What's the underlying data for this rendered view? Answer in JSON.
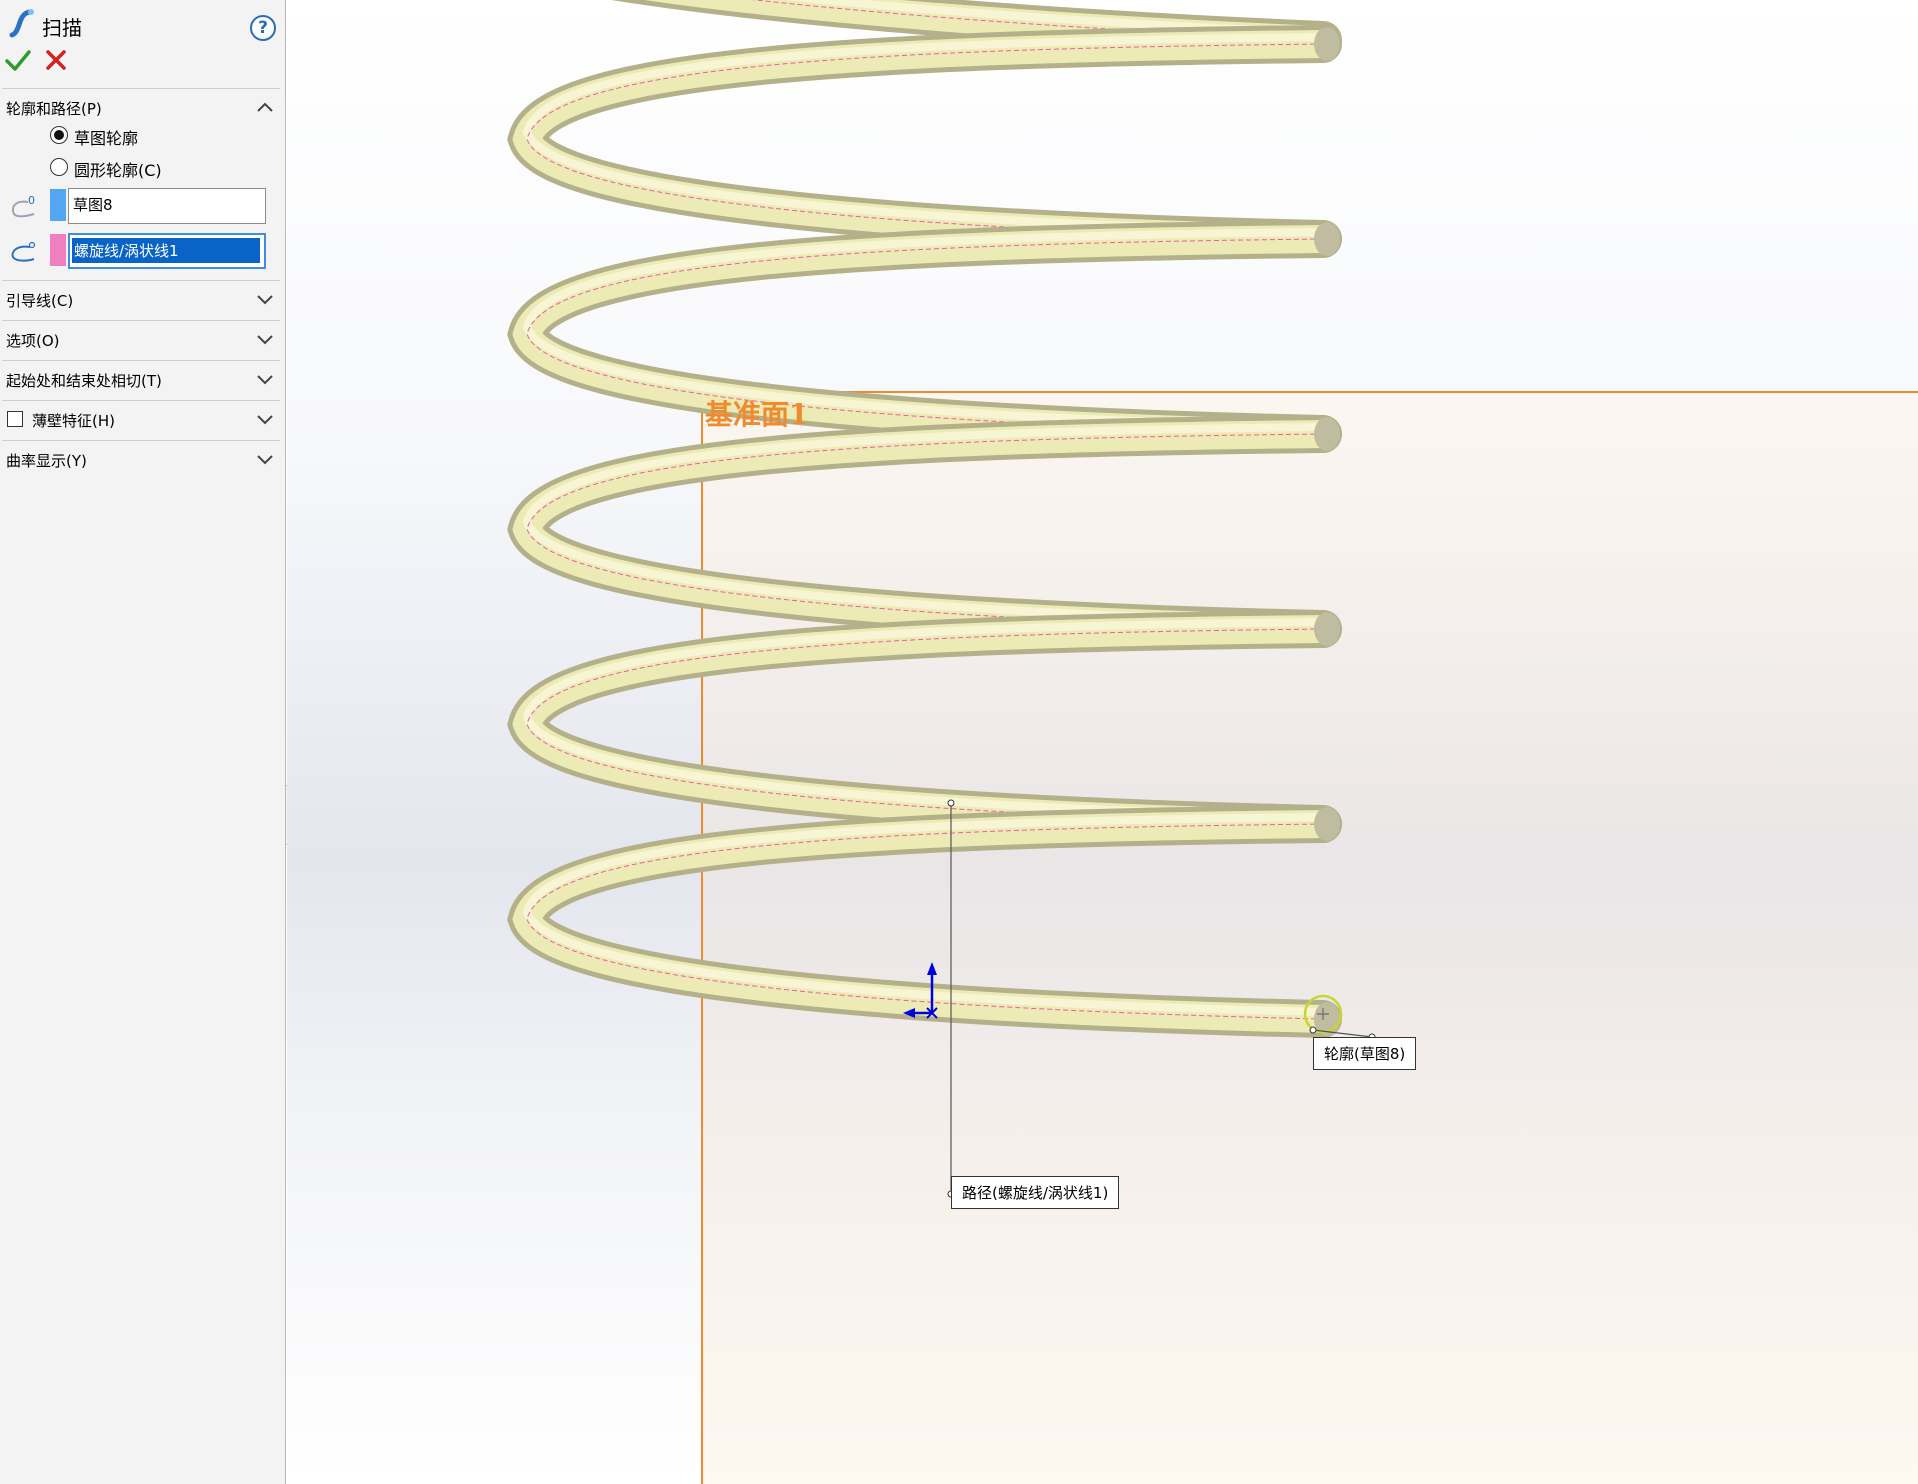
{
  "panel": {
    "title": "扫描",
    "help_label": "?",
    "groups": {
      "profile_path": "轮廓和路径(P)",
      "guide_curves": "引导线(C)",
      "options": "选项(O)",
      "tangency": "起始处和结束处相切(T)",
      "thin_feature": "薄壁特征(H)",
      "curvature_display": "曲率显示(Y)"
    },
    "radios": {
      "sketch_profile": "草图轮廓",
      "circular_profile": "圆形轮廓(C)"
    },
    "profile_selection": "草图8",
    "path_selection": "螺旋线/涡状线1"
  },
  "viewport": {
    "plane_label": "基准面1",
    "profile_callout": "轮廓(草图8)",
    "path_callout": "路径(螺旋线/涡状线1)"
  },
  "colors": {
    "accent_blue": "#0a64c8",
    "plane_orange": "#f08a2c",
    "spring_yellow": "#ecebb5",
    "profile_swatch": "#55a6f2",
    "path_swatch": "#f07fbf"
  }
}
